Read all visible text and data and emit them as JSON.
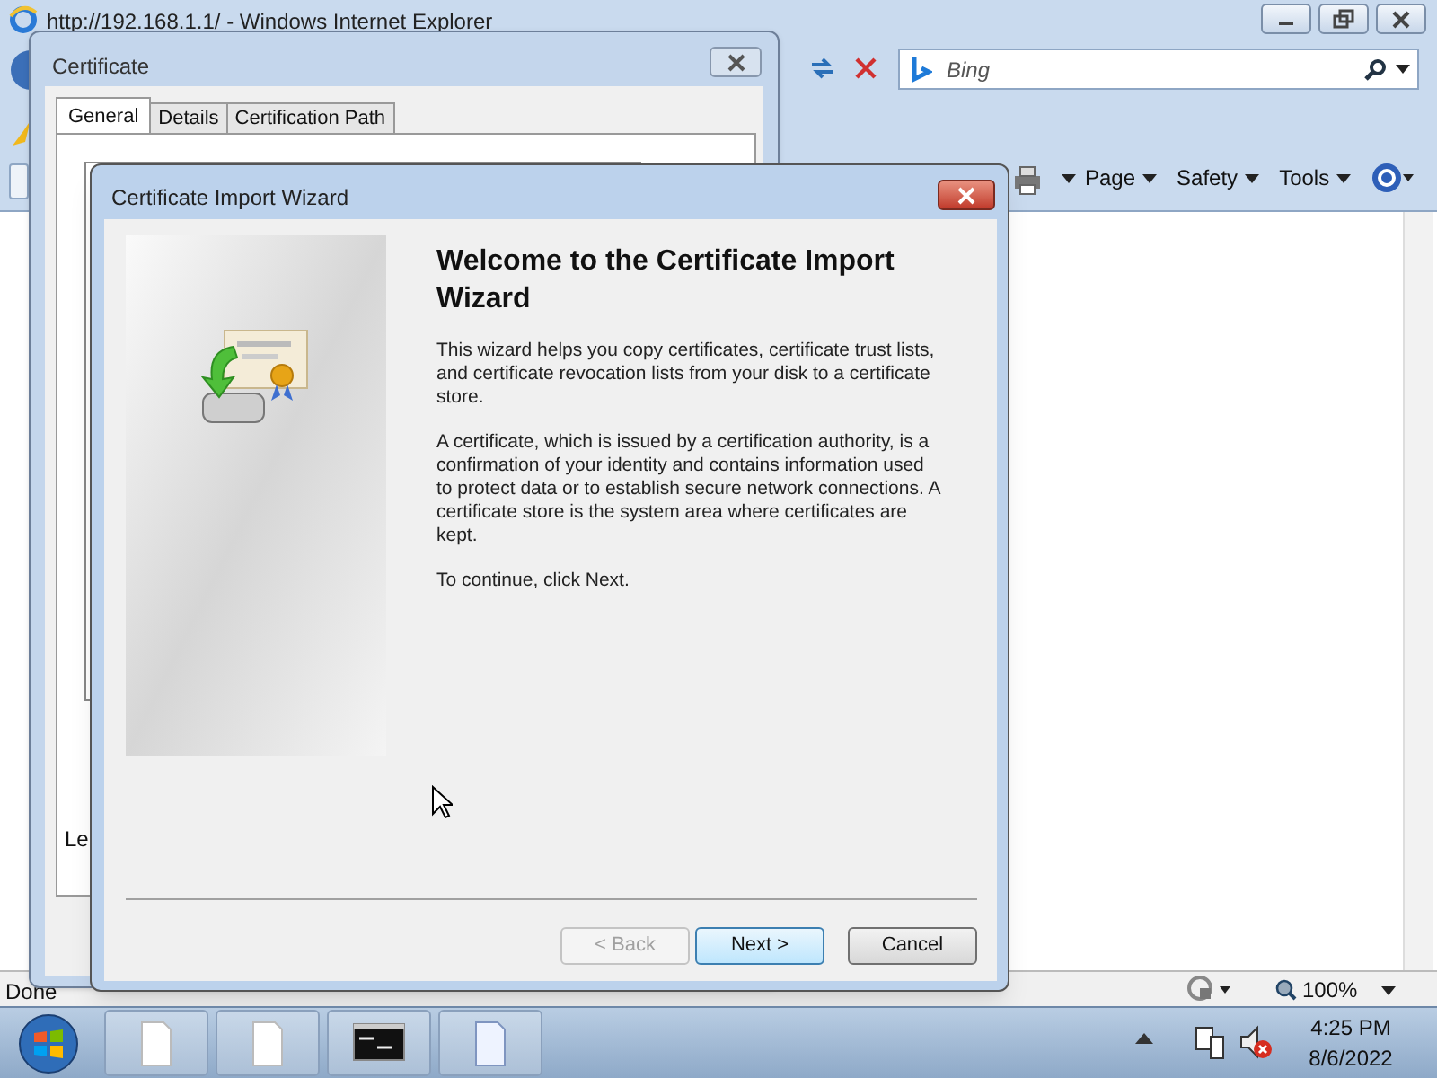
{
  "browser": {
    "title": "http://192.168.1.1/ - Windows Internet Explorer",
    "search_placeholder": "Bing",
    "command_bar": [
      {
        "label": "Page"
      },
      {
        "label": "Safety"
      },
      {
        "label": "Tools"
      }
    ],
    "status": "Done",
    "zoom": "100%"
  },
  "certificate_dialog": {
    "title": "Certificate",
    "tabs": [
      {
        "label": "General",
        "selected": true
      },
      {
        "label": "Details",
        "selected": false
      },
      {
        "label": "Certification Path",
        "selected": false
      }
    ],
    "visible_text": "Le"
  },
  "wizard": {
    "title": "Certificate Import Wizard",
    "heading": "Welcome to the Certificate Import Wizard",
    "paragraphs": [
      "This wizard helps you copy certificates, certificate trust lists, and certificate revocation lists from your disk to a certificate store.",
      "A certificate, which is issued by a certification authority, is a confirmation of your identity and contains information used to protect data or to establish secure network connections. A certificate store is the system area where certificates are kept.",
      "To continue, click Next."
    ],
    "buttons": [
      {
        "label": "< Back",
        "disabled": true,
        "default": false
      },
      {
        "label": "Next >",
        "disabled": false,
        "default": true
      },
      {
        "label": "Cancel",
        "disabled": false,
        "default": false
      }
    ]
  },
  "taskbar": {
    "buttons": [
      {
        "kind": "page"
      },
      {
        "kind": "page"
      },
      {
        "kind": "console"
      },
      {
        "kind": "document"
      }
    ],
    "time": "4:25 PM",
    "date": "8/6/2022"
  }
}
